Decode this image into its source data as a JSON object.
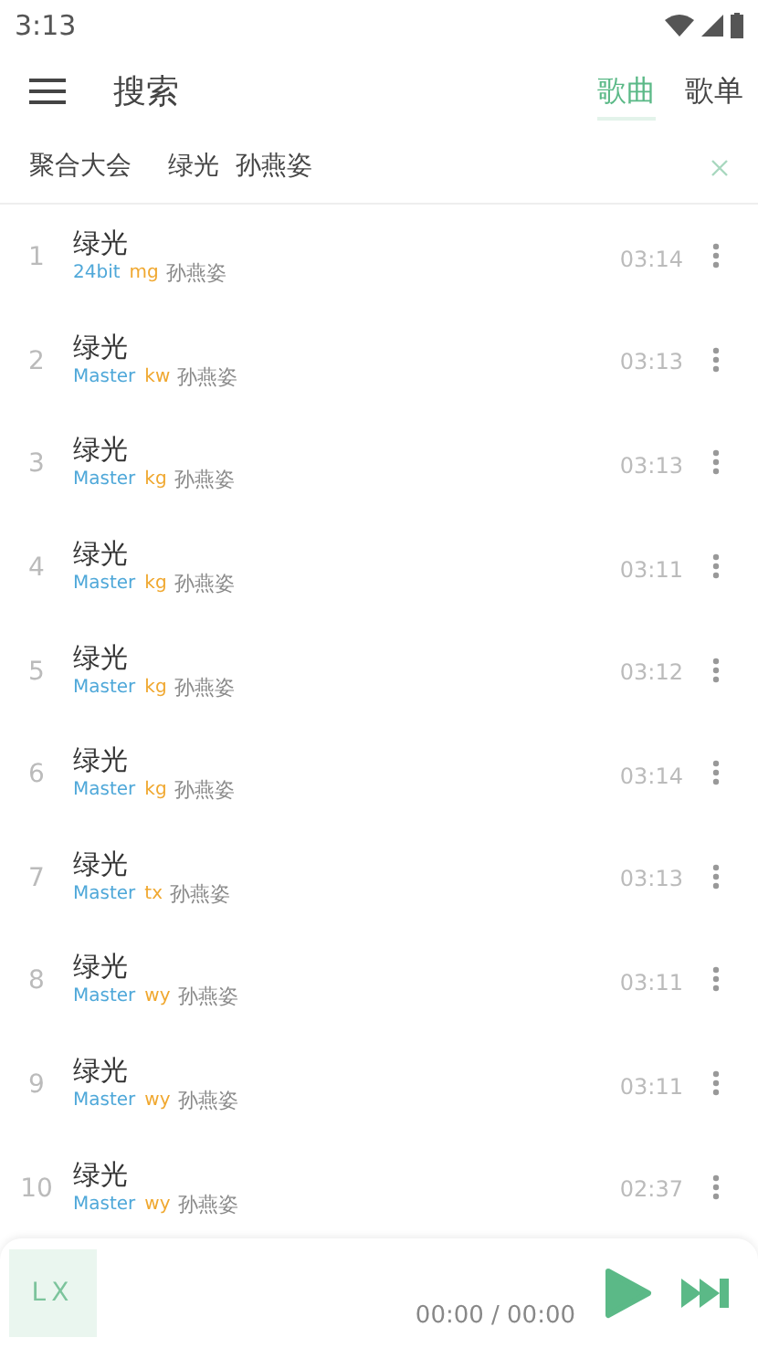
{
  "status_bar": {
    "time": "3:13"
  },
  "toolbar": {
    "title": "搜索",
    "tabs": [
      {
        "label": "歌曲",
        "selected": true
      },
      {
        "label": "歌单",
        "selected": false
      }
    ]
  },
  "search": {
    "source": "聚合大会",
    "value": "绿光  孙燕姿"
  },
  "songs": [
    {
      "index": "1",
      "title": "绿光",
      "quality": "24bit",
      "source": "mg",
      "artist": "孙燕姿",
      "duration": "03:14"
    },
    {
      "index": "2",
      "title": "绿光",
      "quality": "Master",
      "source": "kw",
      "artist": "孙燕姿",
      "duration": "03:13"
    },
    {
      "index": "3",
      "title": "绿光",
      "quality": "Master",
      "source": "kg",
      "artist": "孙燕姿",
      "duration": "03:13"
    },
    {
      "index": "4",
      "title": "绿光",
      "quality": "Master",
      "source": "kg",
      "artist": "孙燕姿",
      "duration": "03:11"
    },
    {
      "index": "5",
      "title": "绿光",
      "quality": "Master",
      "source": "kg",
      "artist": "孙燕姿",
      "duration": "03:12"
    },
    {
      "index": "6",
      "title": "绿光",
      "quality": "Master",
      "source": "kg",
      "artist": "孙燕姿",
      "duration": "03:14"
    },
    {
      "index": "7",
      "title": "绿光",
      "quality": "Master",
      "source": "tx",
      "artist": "孙燕姿",
      "duration": "03:13"
    },
    {
      "index": "8",
      "title": "绿光",
      "quality": "Master",
      "source": "wy",
      "artist": "孙燕姿",
      "duration": "03:11"
    },
    {
      "index": "9",
      "title": "绿光",
      "quality": "Master",
      "source": "wy",
      "artist": "孙燕姿",
      "duration": "03:11"
    },
    {
      "index": "10",
      "title": "绿光",
      "quality": "Master",
      "source": "wy",
      "artist": "孙燕姿",
      "duration": "02:37"
    }
  ],
  "player": {
    "cover": "LX",
    "time": "00:00 / 00:00"
  }
}
